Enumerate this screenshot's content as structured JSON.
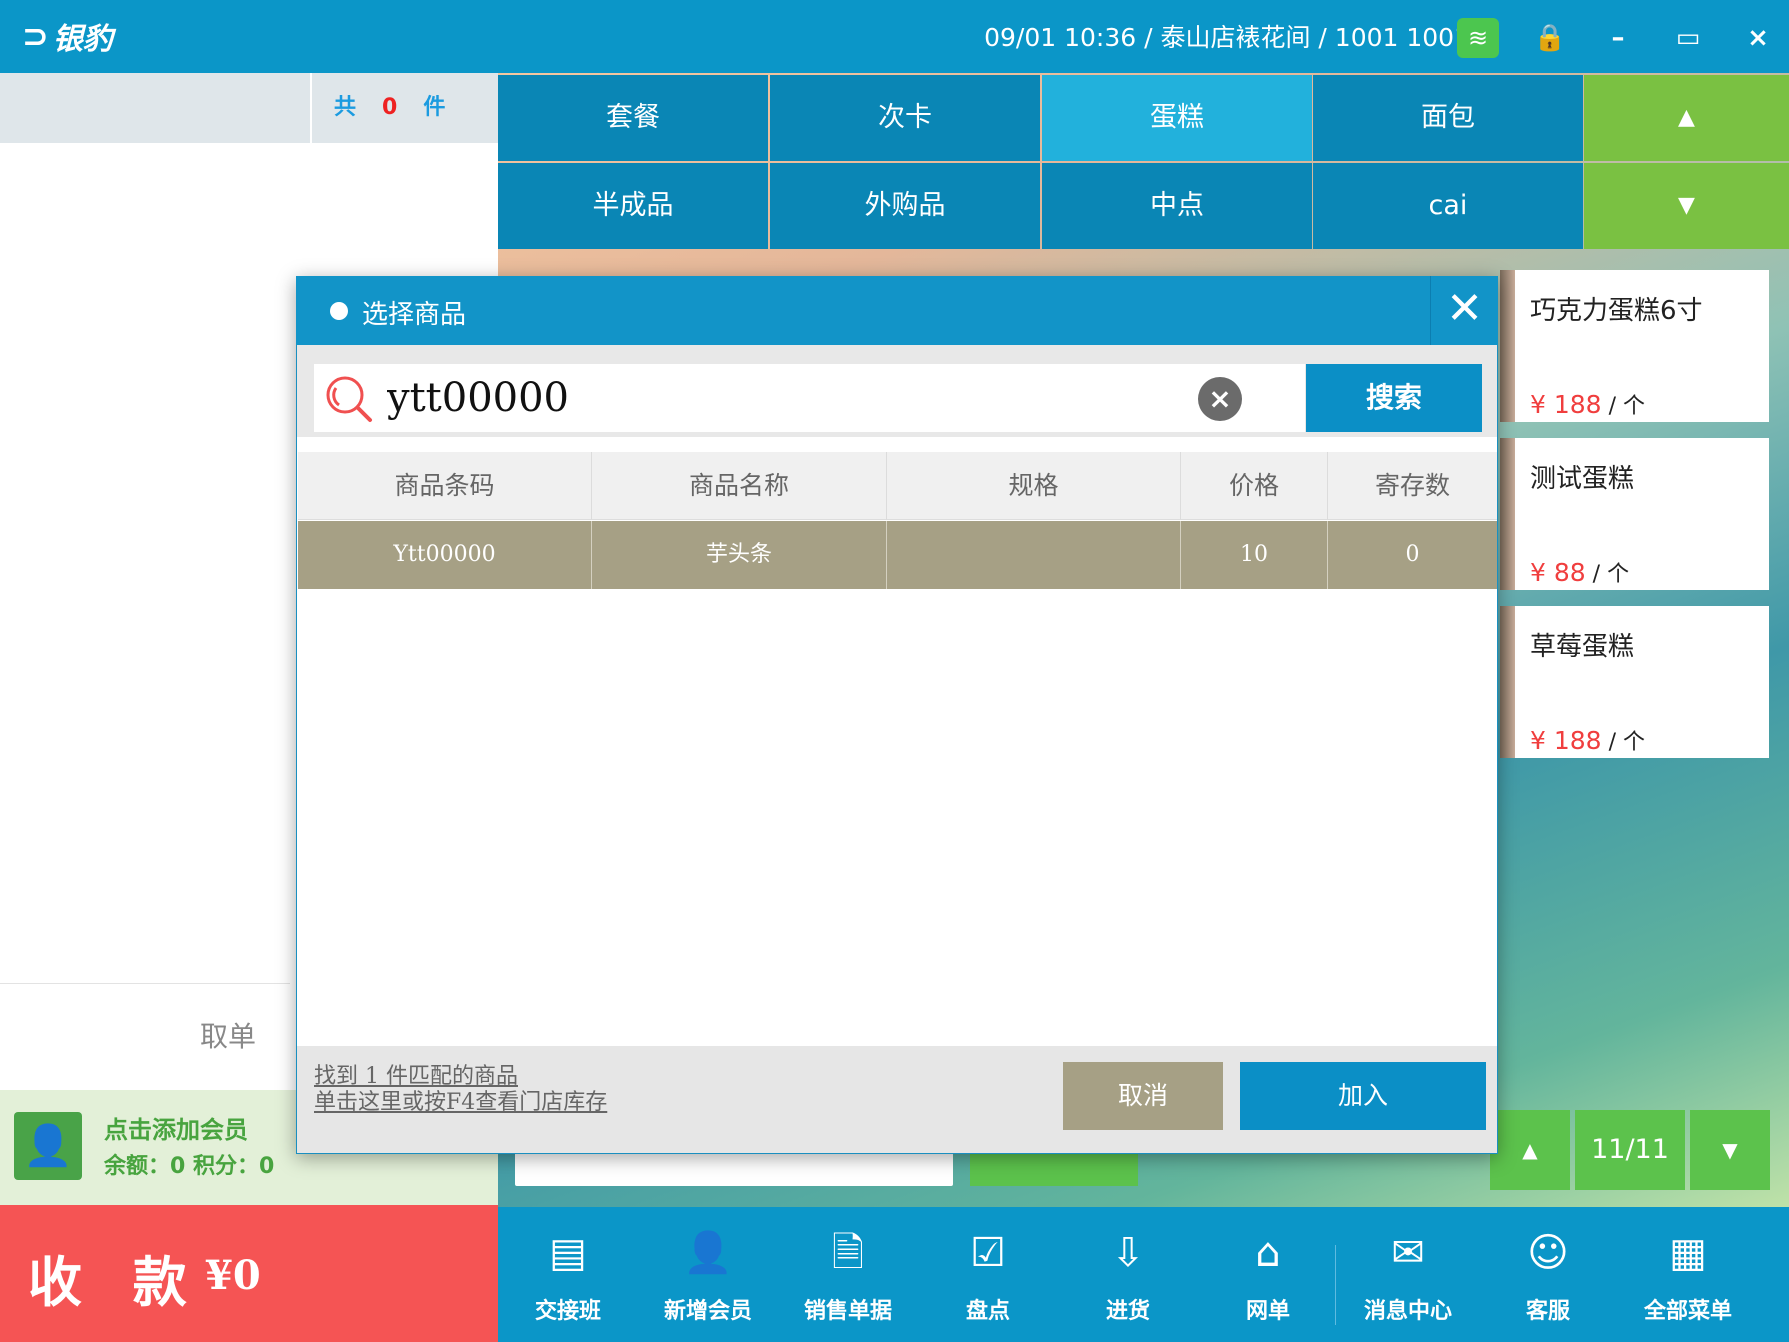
{
  "app": {
    "logo_text": "银豹"
  },
  "status": {
    "text": "09/01 10:36 / 泰山店裱花间 / 1001 1001"
  },
  "icons": {
    "wifi": "wifi-icon",
    "lock": "lock-icon",
    "minimize": "minimize-icon",
    "maximize": "maximize-icon",
    "close": "close-icon"
  },
  "window": {
    "lock_glyph": "🔒",
    "min_glyph": "–",
    "max_glyph": "▭",
    "close_glyph": "×"
  },
  "cart": {
    "total_prefix": "共",
    "count": "0",
    "unit": "件",
    "cancel_label": "取单"
  },
  "member": {
    "add_label": "点击添加会员",
    "info": "余额：0  积分：0"
  },
  "checkout": {
    "label": "收 款",
    "amount": "¥0"
  },
  "categories": {
    "row1": [
      "套餐",
      "次卡",
      "蛋糕",
      "面包"
    ],
    "row2": [
      "半成品",
      "外购品",
      "中点",
      "cai"
    ],
    "active": "蛋糕",
    "up": "▲",
    "down": "▼"
  },
  "products": [
    {
      "name": "巧克力蛋糕6寸",
      "price": "¥ 188",
      "unit": " / 个"
    },
    {
      "name": "测试蛋糕",
      "price": "¥ 88",
      "unit": " / 个"
    },
    {
      "name": "草莓蛋糕",
      "price": "¥ 188",
      "unit": " / 个"
    }
  ],
  "pager": {
    "up": "▲",
    "page": "11/11",
    "down": "▼"
  },
  "toolbar": [
    {
      "label": "交接班",
      "icon": "handover-icon",
      "glyph": "▤"
    },
    {
      "label": "新增会员",
      "icon": "add-member-icon",
      "glyph": "👤"
    },
    {
      "label": "销售单据",
      "icon": "sales-document-icon",
      "glyph": "🗎"
    },
    {
      "label": "盘点",
      "icon": "inventory-check-icon",
      "glyph": "☑"
    },
    {
      "label": "进货",
      "icon": "purchase-icon",
      "glyph": "⇩"
    },
    {
      "label": "网单",
      "icon": "online-order-icon",
      "glyph": "⌂"
    },
    {
      "label": "消息中心",
      "icon": "message-center-icon",
      "glyph": "✉"
    },
    {
      "label": "客服",
      "icon": "customer-service-icon",
      "glyph": "☺"
    },
    {
      "label": "全部菜单",
      "icon": "all-menu-icon",
      "glyph": "▦"
    }
  ],
  "dialog": {
    "title": "选择商品",
    "search_value": "ytt00000",
    "search_button": "搜索",
    "clear_glyph": "×",
    "close_glyph": "✕",
    "columns": [
      "商品条码",
      "商品名称",
      "规格",
      "价格",
      "寄存数"
    ],
    "rows": [
      {
        "barcode": "Ytt00000",
        "name": "芋头条",
        "spec": "",
        "price": "10",
        "stock": "0"
      }
    ],
    "found_text": "找到  1  件匹配的商品",
    "stock_link": "单击这里或按F4查看门店库存",
    "cancel_label": "取消",
    "add_label": "加入"
  }
}
